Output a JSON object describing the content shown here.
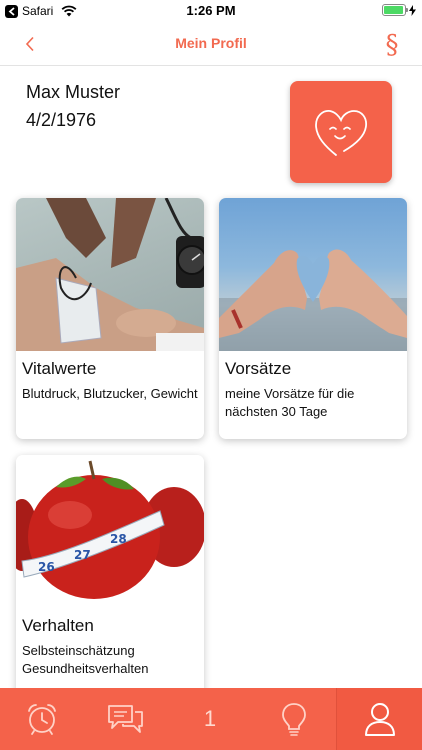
{
  "status_bar": {
    "app_label": "Safari",
    "time": "1:26 PM",
    "battery_level": 0.95
  },
  "nav": {
    "title": "Mein Profil",
    "back_icon": "chevron-left-icon",
    "legal_icon": "section-sign-icon",
    "legal_symbol": "§"
  },
  "profile": {
    "name": "Max Muster",
    "dob": "4/2/1976",
    "avatar_icon": "smiling-heart-icon"
  },
  "cards": [
    {
      "title": "Vitalwerte",
      "subtitle": "Blutdruck, Blutzucker, Gewicht",
      "image": "blood-pressure-measurement-photo"
    },
    {
      "title": "Vorsätze",
      "subtitle": "meine Vorsätze für die nächsten 30 Tage",
      "image": "heart-hands-photo"
    },
    {
      "title": "Verhalten",
      "subtitle": "Selbsteinschätzung Gesundheitsverhalten",
      "image": "apple-measuring-tape-photo"
    }
  ],
  "tab_bar": {
    "tabs": [
      {
        "name": "alarm",
        "icon": "alarm-clock-icon"
      },
      {
        "name": "chat",
        "icon": "chat-bubbles-icon"
      },
      {
        "name": "count",
        "label": "1"
      },
      {
        "name": "tip",
        "icon": "lightbulb-icon"
      },
      {
        "name": "profile",
        "icon": "person-icon",
        "active": true
      }
    ]
  },
  "colors": {
    "accent": "#f26a50",
    "tab_bar": "#f4624a",
    "avatar_bg": "#f4624a"
  }
}
